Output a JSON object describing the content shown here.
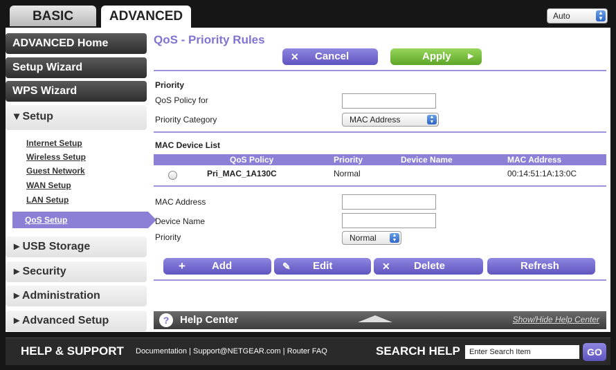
{
  "tabs": {
    "basic": "BASIC",
    "advanced": "ADVANCED"
  },
  "language_select": "Auto",
  "sidebar": {
    "advanced_home": "ADVANCED Home",
    "setup_wizard": "Setup Wizard",
    "wps_wizard": "WPS Wizard",
    "setup": "▾ Setup",
    "sub_items": [
      "Internet Setup",
      "Wireless Setup",
      "Guest Network",
      "WAN Setup",
      "LAN Setup"
    ],
    "qos_setup": "QoS Setup",
    "usb_storage": "▸ USB Storage",
    "security": "▸ Security",
    "administration": "▸ Administration",
    "advanced_setup": "▸ Advanced Setup"
  },
  "page": {
    "title": "QoS - Priority Rules",
    "cancel": "Cancel",
    "apply": "Apply",
    "priority_heading": "Priority",
    "qos_policy_for": "QoS Policy for",
    "qos_policy_value": "",
    "priority_category": "Priority Category",
    "priority_category_value": "MAC Address",
    "mac_device_list": "MAC Device List",
    "columns": [
      "QoS Policy",
      "Priority",
      "Device Name",
      "MAC Address"
    ],
    "rows": [
      {
        "policy": "Pri_MAC_1A130C",
        "priority": "Normal",
        "device": "",
        "mac": "00:14:51:1A:13:0C"
      }
    ],
    "mac_address_label": "MAC Address",
    "mac_address_value": "",
    "device_name_label": "Device Name",
    "device_name_value": "",
    "priority_label": "Priority",
    "priority_value": "Normal",
    "add": "Add",
    "edit": "Edit",
    "delete": "Delete",
    "refresh": "Refresh"
  },
  "help_center": {
    "label": "Help Center",
    "toggle": "Show/Hide Help Center"
  },
  "footer": {
    "help_support": "HELP & SUPPORT",
    "documentation": "Documentation",
    "support_email": "Support@NETGEAR.com",
    "router_faq": "Router FAQ",
    "search_help": "SEARCH HELP",
    "search_placeholder": "Enter Search Item",
    "go": "GO"
  }
}
